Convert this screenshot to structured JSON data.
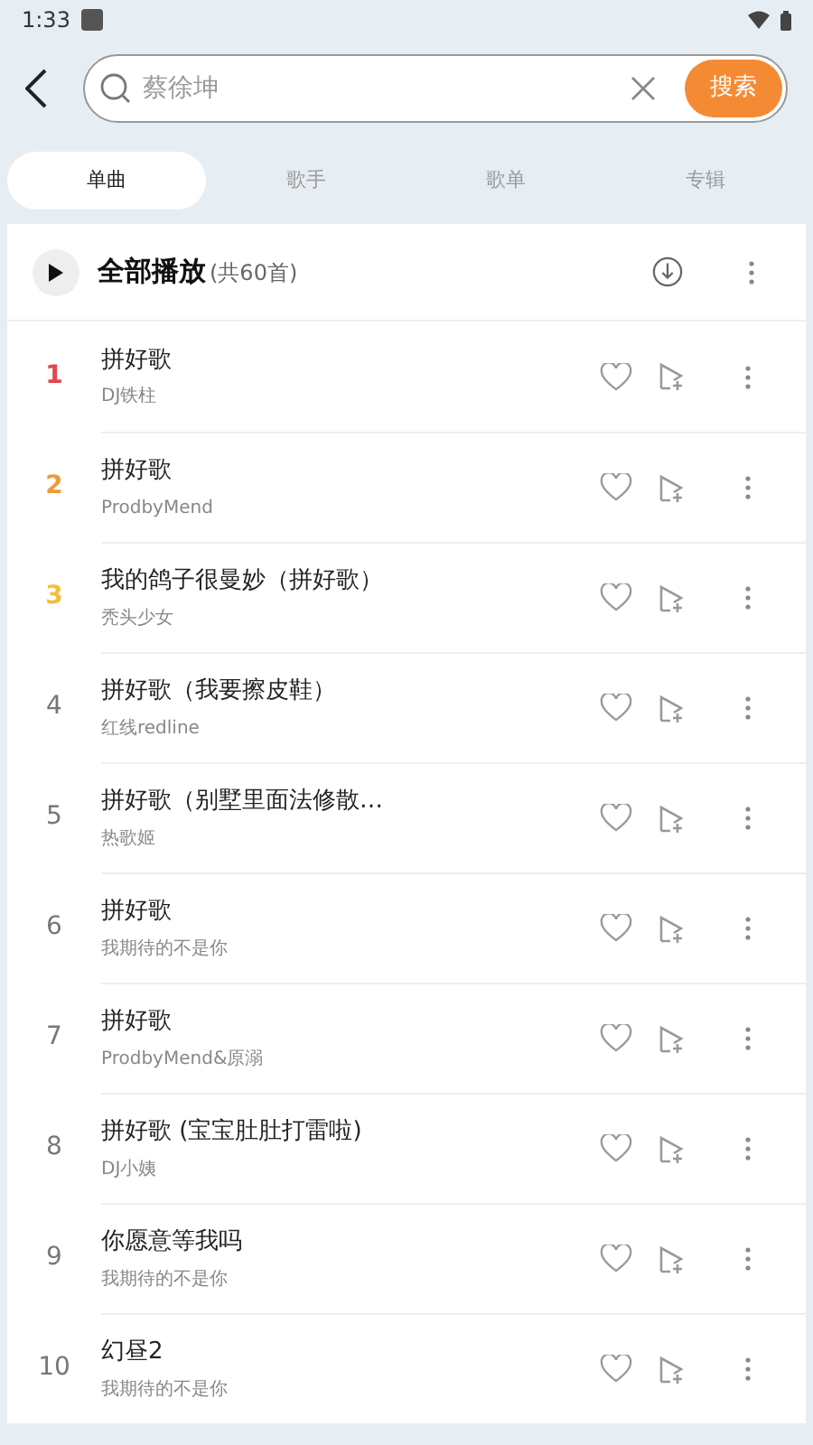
{
  "status_bar": {
    "time": "1:33"
  },
  "search": {
    "value": "蔡徐坤",
    "button": "搜索"
  },
  "tabs": [
    {
      "label": "单曲",
      "selected": true
    },
    {
      "label": "歌手",
      "selected": false
    },
    {
      "label": "歌单",
      "selected": false
    },
    {
      "label": "专辑",
      "selected": false
    }
  ],
  "play_all": {
    "label": "全部播放",
    "count": "(共60首)"
  },
  "songs": [
    {
      "rank": "1",
      "color": "#e0474f",
      "title": "拼好歌",
      "artist": "DJ铁柱"
    },
    {
      "rank": "2",
      "color": "#ee9a3a",
      "title": "拼好歌",
      "artist": "ProdbyMend"
    },
    {
      "rank": "3",
      "color": "#f2bf3d",
      "title": "我的鸽子很曼妙（拼好歌）",
      "artist": "秃头少女"
    },
    {
      "rank": "4",
      "color": "#777777",
      "title": "拼好歌（我要擦皮鞋）",
      "artist": "红线redline"
    },
    {
      "rank": "5",
      "color": "#777777",
      "title": "拼好歌（别墅里面法修散…",
      "artist": "热歌姬"
    },
    {
      "rank": "6",
      "color": "#777777",
      "title": "拼好歌",
      "artist": "我期待的不是你"
    },
    {
      "rank": "7",
      "color": "#777777",
      "title": "拼好歌",
      "artist": "ProdbyMend&原溺"
    },
    {
      "rank": "8",
      "color": "#777777",
      "title": "拼好歌 (宝宝肚肚打雷啦)",
      "artist": "DJ小姨"
    },
    {
      "rank": "9",
      "color": "#777777",
      "title": "你愿意等我吗",
      "artist": "我期待的不是你"
    },
    {
      "rank": "10",
      "color": "#777777",
      "title": "幻昼2",
      "artist": "我期待的不是你"
    }
  ]
}
